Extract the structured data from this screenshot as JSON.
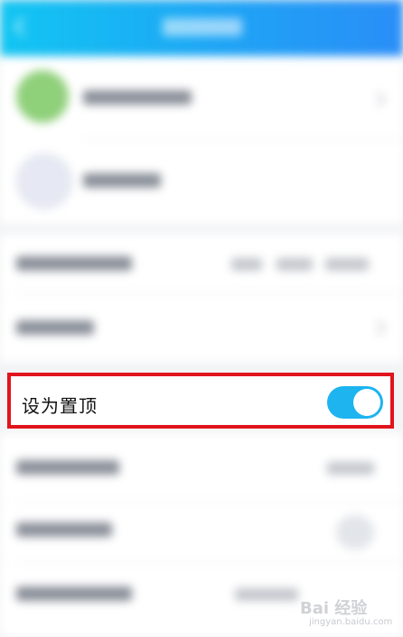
{
  "header": {
    "back_icon": "back-arrow-icon"
  },
  "pin_row": {
    "label": "设为置顶",
    "toggle_on": true,
    "toggle_color": "#1db4f0",
    "highlight_color": "#e1141e"
  },
  "watermark": {
    "logo": "Bai 经验",
    "url": "jingyan.baidu.com"
  }
}
